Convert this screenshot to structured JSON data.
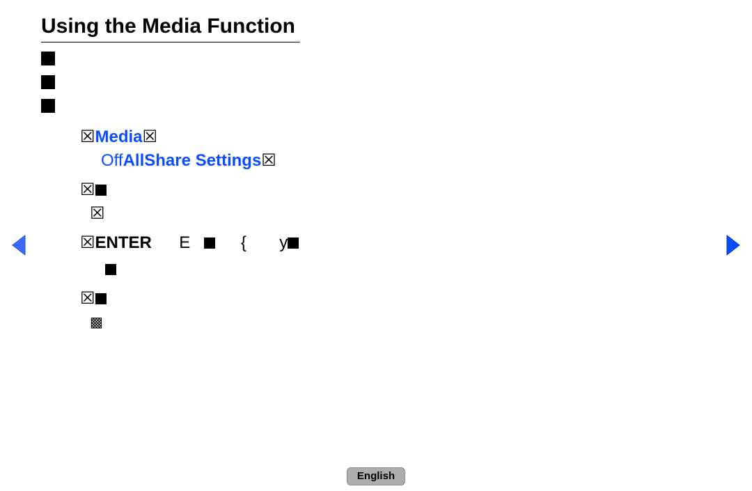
{
  "title": "Using the Media Function",
  "bullets": {
    "b1": "",
    "b2": "",
    "b3": ""
  },
  "content": {
    "row1_pre": "☒",
    "row1_media": "Media",
    "row1_post": "☒",
    "row2_off": "Off",
    "row2_allshare": "AllShare Settings",
    "row2_post": "☒",
    "row3": "☒",
    "row4": "☒",
    "row5_pre": "☒",
    "row5_enter": "ENTER",
    "row5_e": "E",
    "row5_brace": "{",
    "row5_y": "y",
    "row6": "",
    "row7": "☒",
    "row8": "▩"
  },
  "nav": {
    "left": "prev",
    "right": "next"
  },
  "footer": {
    "language": "English"
  }
}
